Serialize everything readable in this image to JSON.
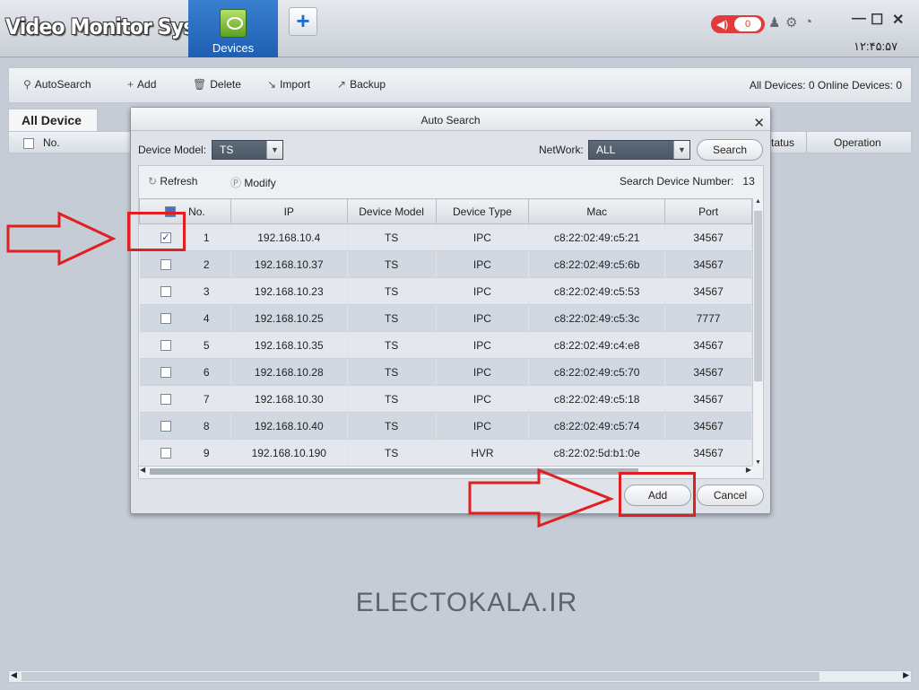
{
  "app": {
    "title": "Video Monitor System",
    "tab_devices": "Devices",
    "plus": "+",
    "alarm_count": "0",
    "clock": "١٢:۴۵:۵٧"
  },
  "toolbar": {
    "autosearch": "AutoSearch",
    "add": "Add",
    "delete": "Delete",
    "import": "Import",
    "backup": "Backup",
    "all_devices_label": "All Devices:",
    "all_devices_value": "0",
    "online_label": "Online Devices:",
    "online_value": "0"
  },
  "device_list": {
    "tab": "All Device",
    "col_no": "No.",
    "col_status": "tatus",
    "col_operation": "Operation"
  },
  "dialog": {
    "title": "Auto Search",
    "device_model_label": "Device Model:",
    "device_model_value": "TS",
    "network_label": "NetWork:",
    "network_value": "ALL",
    "search_button": "Search",
    "refresh": "Refresh",
    "modify": "Modify",
    "search_number_label": "Search Device Number:",
    "search_number_value": "13",
    "columns": [
      "No.",
      "IP",
      "Device Model",
      "Device Type",
      "Mac",
      "Port"
    ],
    "rows": [
      {
        "checked": true,
        "no": "1",
        "ip": "192.168.10.4",
        "model": "TS",
        "type": "IPC",
        "mac": "c8:22:02:49:c5:21",
        "port": "34567"
      },
      {
        "checked": false,
        "no": "2",
        "ip": "192.168.10.37",
        "model": "TS",
        "type": "IPC",
        "mac": "c8:22:02:49:c5:6b",
        "port": "34567"
      },
      {
        "checked": false,
        "no": "3",
        "ip": "192.168.10.23",
        "model": "TS",
        "type": "IPC",
        "mac": "c8:22:02:49:c5:53",
        "port": "34567"
      },
      {
        "checked": false,
        "no": "4",
        "ip": "192.168.10.25",
        "model": "TS",
        "type": "IPC",
        "mac": "c8:22:02:49:c5:3c",
        "port": "7777"
      },
      {
        "checked": false,
        "no": "5",
        "ip": "192.168.10.35",
        "model": "TS",
        "type": "IPC",
        "mac": "c8:22:02:49:c4:e8",
        "port": "34567"
      },
      {
        "checked": false,
        "no": "6",
        "ip": "192.168.10.28",
        "model": "TS",
        "type": "IPC",
        "mac": "c8:22:02:49:c5:70",
        "port": "34567"
      },
      {
        "checked": false,
        "no": "7",
        "ip": "192.168.10.30",
        "model": "TS",
        "type": "IPC",
        "mac": "c8:22:02:49:c5:18",
        "port": "34567"
      },
      {
        "checked": false,
        "no": "8",
        "ip": "192.168.10.40",
        "model": "TS",
        "type": "IPC",
        "mac": "c8:22:02:49:c5:74",
        "port": "34567"
      },
      {
        "checked": false,
        "no": "9",
        "ip": "192.168.10.190",
        "model": "TS",
        "type": "HVR",
        "mac": "c8:22:02:5d:b1:0e",
        "port": "34567"
      }
    ],
    "add_button": "Add",
    "cancel_button": "Cancel"
  },
  "watermark": "ELECTOKALA.IR",
  "colors": {
    "accent": "#1f5fb3",
    "alarm": "#e23b3b",
    "highlight": "#e02020"
  }
}
